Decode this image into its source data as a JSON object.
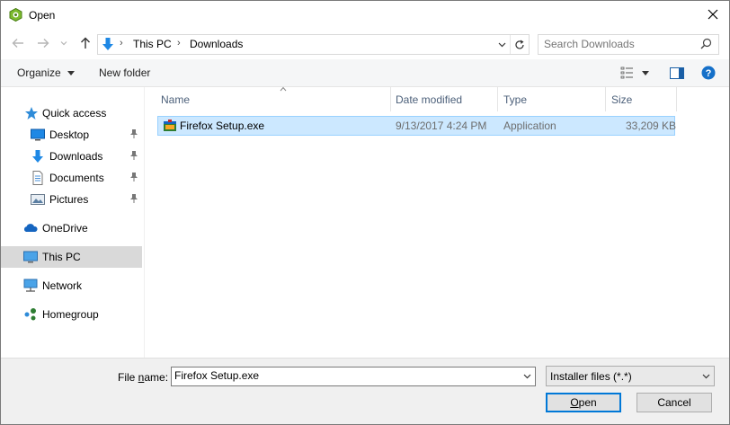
{
  "window": {
    "title": "Open",
    "close_icon": "close-icon"
  },
  "nav": {
    "back": "back-arrow-icon",
    "forward": "forward-arrow-icon",
    "recent": "chevron-down-icon",
    "up": "up-arrow-icon"
  },
  "address": {
    "icon": "downloads-icon",
    "crumbs": [
      "This PC",
      "Downloads"
    ],
    "separator": "›"
  },
  "search": {
    "placeholder": "Search Downloads"
  },
  "toolbar": {
    "organize_label": "Organize",
    "new_folder_label": "New folder"
  },
  "sidebar": {
    "items": [
      {
        "label": "Quick access",
        "icon": "star-icon"
      },
      {
        "label": "Desktop",
        "icon": "desktop-icon",
        "pinned": true
      },
      {
        "label": "Downloads",
        "icon": "downloads-icon",
        "pinned": true
      },
      {
        "label": "Documents",
        "icon": "documents-icon",
        "pinned": true
      },
      {
        "label": "Pictures",
        "icon": "pictures-icon",
        "pinned": true
      },
      {
        "label": "OneDrive",
        "icon": "cloud-icon"
      },
      {
        "label": "This PC",
        "icon": "computer-icon",
        "selected": true
      },
      {
        "label": "Network",
        "icon": "network-icon"
      },
      {
        "label": "Homegroup",
        "icon": "homegroup-icon"
      }
    ]
  },
  "columns": {
    "name": "Name",
    "date": "Date modified",
    "type": "Type",
    "size": "Size"
  },
  "files": [
    {
      "name": "Firefox Setup.exe",
      "date": "9/13/2017 4:24 PM",
      "type": "Application",
      "size": "33,209 KB"
    }
  ],
  "bottom": {
    "filename_label_pre": "File ",
    "filename_label_accel": "n",
    "filename_label_post": "ame:",
    "filename_value": "Firefox Setup.exe",
    "filter_value": "Installer files (*.*)",
    "open_accel": "O",
    "open_rest": "pen",
    "cancel_label": "Cancel"
  },
  "colors": {
    "accent": "#0078d7",
    "selection": "#cce8ff",
    "selection_border": "#99d1ff",
    "header_text": "#4c607a"
  }
}
